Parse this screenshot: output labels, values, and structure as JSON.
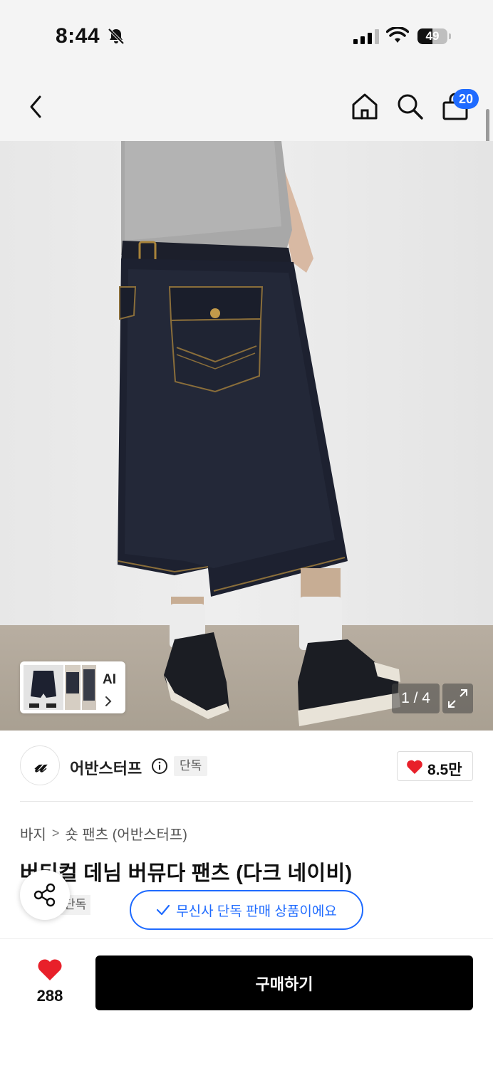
{
  "status_bar": {
    "time": "8:44",
    "battery": "49",
    "battery_level_percent": 49
  },
  "nav": {
    "icons": [
      "back-icon",
      "home-icon",
      "search-icon",
      "cart-icon"
    ],
    "cart_count": "20",
    "accent_color": "#1f6bff"
  },
  "gallery": {
    "counter": "1 / 4",
    "ai_label": "AI"
  },
  "brand": {
    "logo": "𝓊",
    "name": "어반스터프",
    "exclusive_tag": "단독",
    "like_count": "8.5만"
  },
  "breadcrumb": {
    "category": "바지",
    "separator": ">",
    "subcategory": "숏 팬츠 (어반스터프)"
  },
  "product": {
    "title": "버티컬 데님 버뮤다 팬츠 (다크 네이비)",
    "tag": "단독"
  },
  "exclusive_pill": {
    "label": "무신사 단독 판매 상품이에요"
  },
  "bottom": {
    "wish_count": "288",
    "buy_label": "구매하기"
  }
}
